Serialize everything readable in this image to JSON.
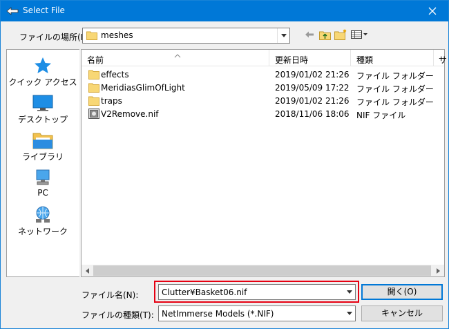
{
  "window": {
    "title": "Select File"
  },
  "location": {
    "label": "ファイルの場所(I):",
    "value": "meshes"
  },
  "places": [
    {
      "name": "quick-access",
      "label": "クイック アクセス",
      "icon": "star-icon"
    },
    {
      "name": "desktop",
      "label": "デスクトップ",
      "icon": "desktop-icon"
    },
    {
      "name": "libraries",
      "label": "ライブラリ",
      "icon": "library-icon"
    },
    {
      "name": "pc",
      "label": "PC",
      "icon": "computer-icon"
    },
    {
      "name": "network",
      "label": "ネットワーク",
      "icon": "network-icon"
    }
  ],
  "columns": {
    "name": "名前",
    "date": "更新日時",
    "type": "種類",
    "size": "サ"
  },
  "files": [
    {
      "name": "effects",
      "date": "2019/01/02 21:26",
      "type": "ファイル フォルダー",
      "icon": "folder-icon"
    },
    {
      "name": "MeridiasGlimOfLight",
      "date": "2019/05/09 17:22",
      "type": "ファイル フォルダー",
      "icon": "folder-icon"
    },
    {
      "name": "traps",
      "date": "2019/01/02 21:26",
      "type": "ファイル フォルダー",
      "icon": "folder-icon"
    },
    {
      "name": "V2Remove.nif",
      "date": "2018/11/06 18:06",
      "type": "NIF ファイル",
      "icon": "nif-file-icon"
    }
  ],
  "form": {
    "filename_label": "ファイル名(N):",
    "filename_value": "Clutter¥Basket06.nif",
    "filetype_label": "ファイルの種類(T):",
    "filetype_value": "NetImmerse Models (*.NIF)",
    "open_label": "開く(O)",
    "cancel_label": "キャンセル"
  },
  "colors": {
    "titlebar": "#0078d7",
    "highlight": "#e60012",
    "folder": "#f8d775"
  }
}
